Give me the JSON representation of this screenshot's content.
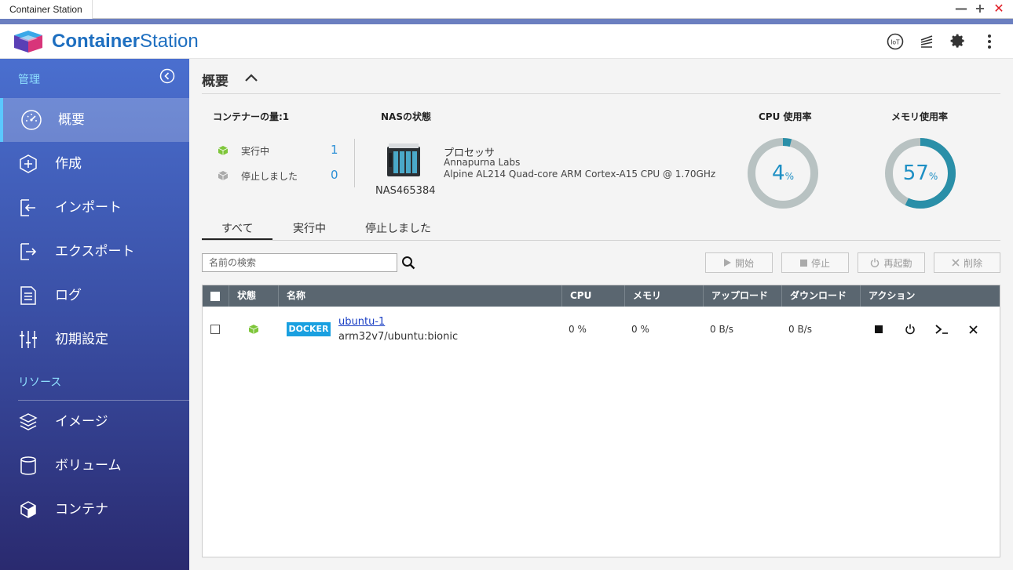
{
  "window": {
    "tab_title": "Container Station",
    "min_symbol": "—",
    "max_symbol": "+",
    "close_symbol": "✕"
  },
  "brand": {
    "name_bold": "Container",
    "name_thin": "Station",
    "color": "#1e6fc0"
  },
  "header_icons": [
    "iot-icon",
    "stack-icon",
    "gear-icon",
    "more-icon"
  ],
  "header": {
    "iot_label": "IoT"
  },
  "sidebar": {
    "section_manage": "管理",
    "section_resources": "リソース",
    "items": [
      {
        "label": "概要",
        "icon": "dashboard-icon",
        "active": true
      },
      {
        "label": "作成",
        "icon": "plus-icon"
      },
      {
        "label": "インポート",
        "icon": "import-icon"
      },
      {
        "label": "エクスポート",
        "icon": "export-icon"
      },
      {
        "label": "ログ",
        "icon": "log-icon"
      },
      {
        "label": "初期設定",
        "icon": "sliders-icon"
      }
    ],
    "resource_items": [
      {
        "label": "イメージ",
        "icon": "layers-icon"
      },
      {
        "label": "ボリューム",
        "icon": "database-icon"
      },
      {
        "label": "コンテナ",
        "icon": "cube-icon"
      }
    ]
  },
  "overview": {
    "title": "概要",
    "container_count_label": "コンテナーの量:1",
    "running_label": "実行中",
    "running_count": "1",
    "stopped_label": "停止しました",
    "stopped_count": "0",
    "nas_status_label": "NASの状態",
    "nas_name": "NAS465384",
    "processor_label": "プロセッサ",
    "processor_vendor": "Annapurna Labs",
    "processor_model": "Alpine AL214 Quad-core ARM Cortex-A15 CPU @ 1.70GHz",
    "cpu_label": "CPU 使用率",
    "cpu_value": "4",
    "cpu_percent": 4,
    "mem_label": "メモリ使用率",
    "mem_value": "57",
    "mem_percent": 57,
    "percent_sign": "%",
    "gauge_color": "#2a8fa8",
    "gauge_track": "#b8c2c2"
  },
  "tabs": [
    {
      "label": "すべて",
      "active": true
    },
    {
      "label": "実行中"
    },
    {
      "label": "停止しました"
    }
  ],
  "search": {
    "placeholder": "名前の検索"
  },
  "actions": {
    "start": "開始",
    "stop": "停止",
    "restart": "再起動",
    "delete": "削除"
  },
  "table": {
    "columns": [
      "状態",
      "名称",
      "CPU",
      "メモリ",
      "アップロード",
      "ダウンロード",
      "アクション"
    ],
    "rows": [
      {
        "badge": "DOCKER",
        "name": "ubuntu-1",
        "image": "arm32v7/ubuntu:bionic",
        "cpu": "0 %",
        "memory": "0 %",
        "upload": "0 B/s",
        "download": "0 B/s"
      }
    ]
  }
}
